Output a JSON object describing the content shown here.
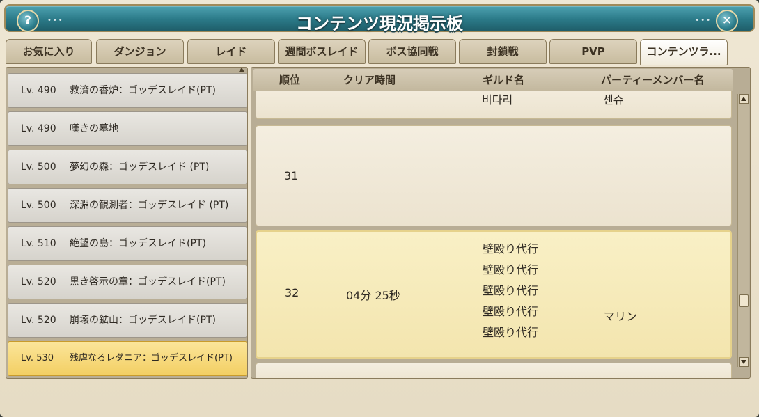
{
  "window": {
    "title": "コンテンツ現況掲示板",
    "help_glyph": "?",
    "close_glyph": "✕",
    "title_dots": "•••"
  },
  "tabs": [
    {
      "label": "お気に入り"
    },
    {
      "label": "ダンジョン"
    },
    {
      "label": "レイド"
    },
    {
      "label": "週間ボスレイド"
    },
    {
      "label": "ボス協同戦"
    },
    {
      "label": "封鎖戦"
    },
    {
      "label": "PVP"
    },
    {
      "label": "コンテンツラ..."
    }
  ],
  "content_list": [
    {
      "lv": "Lv. 490",
      "name": "救済の香炉：ゴッデスレイド(PT)"
    },
    {
      "lv": "Lv. 490",
      "name": "嘆きの墓地"
    },
    {
      "lv": "Lv. 500",
      "name": "夢幻の森：ゴッデスレイド (PT)"
    },
    {
      "lv": "Lv. 500",
      "name": "深淵の観測者：ゴッデスレイド (PT)"
    },
    {
      "lv": "Lv. 510",
      "name": "絶望の島：ゴッデスレイド(PT)"
    },
    {
      "lv": "Lv. 520",
      "name": "黒き啓示の章：ゴッデスレイド(PT)"
    },
    {
      "lv": "Lv. 520",
      "name": "崩壊の鉱山：ゴッデスレイド(PT)"
    },
    {
      "lv": "Lv. 530",
      "name": "残虐なるレダニア：ゴッデスレイド(PT)"
    }
  ],
  "ranking": {
    "headers": {
      "rank": "順位",
      "clear_time": "クリア時間",
      "guild": "ギルド名",
      "party": "パーティーメンバー名"
    },
    "partial_row": {
      "guild": "비다리",
      "party": "센슈"
    },
    "rows": [
      {
        "rank": "31",
        "time": "",
        "guilds": [],
        "party": ""
      },
      {
        "rank": "32",
        "time": "04分 25秒",
        "guilds": [
          "壁殴り代行",
          "壁殴り代行",
          "壁殴り代行",
          "壁殴り代行",
          "壁殴り代行"
        ],
        "party": "マリン"
      }
    ]
  },
  "colors": {
    "title_bar": "#2b7a88",
    "selected_item": "#f3cf63",
    "highlight_row": "#f3e5ae"
  }
}
